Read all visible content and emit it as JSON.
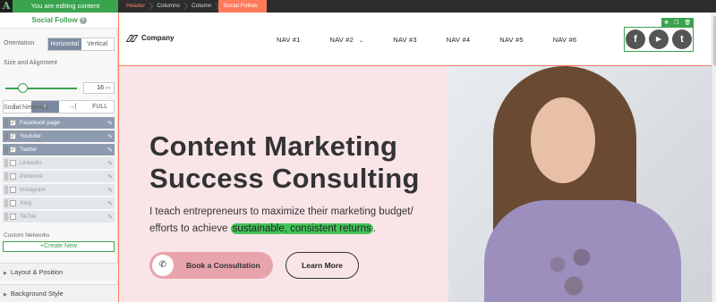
{
  "topbar": {
    "logo": "A",
    "editing": "You are editing content",
    "breadcrumbs": [
      "Header",
      "Columns",
      "Column",
      "Social Follow"
    ]
  },
  "panel": {
    "title": "Social Follow",
    "help": "?",
    "orientation_label": "Orientation",
    "orientation_options": [
      "Horizontal",
      "Vertical"
    ],
    "size_label": "Size and Alignment",
    "size_value": "16",
    "size_unit": "PX",
    "align_options": [
      "|←",
      "+",
      "→|",
      "FULL"
    ],
    "networks_label": "Social Networks",
    "networks": [
      {
        "name": "Facebook page",
        "enabled": true
      },
      {
        "name": "Youtube",
        "enabled": true
      },
      {
        "name": "Twitter",
        "enabled": true
      },
      {
        "name": "LinkedIn",
        "enabled": false
      },
      {
        "name": "Pinterest",
        "enabled": false
      },
      {
        "name": "Instagram",
        "enabled": false
      },
      {
        "name": "Xing",
        "enabled": false
      },
      {
        "name": "TikTok",
        "enabled": false
      }
    ],
    "custom_label": "Custom Networks",
    "create_new": "+Create New",
    "sections": [
      "Layout & Position",
      "Background Style"
    ]
  },
  "site": {
    "brand": "Company",
    "nav": [
      "NAV #1",
      "NAV #2",
      "NAV #3",
      "NAV #4",
      "NAV #5",
      "NAV #6"
    ],
    "social": [
      "f",
      "▶",
      "t"
    ],
    "headline_1": "Content Marketing",
    "headline_2": "Success Consulting",
    "sub_1": "I teach entrepreneurs to maximize their marketing budget/",
    "sub_2": "efforts to achieve",
    "sub_highlight": "sustainable, consistent returns",
    "sub_end": ".",
    "cta_primary": "Book a Consultation",
    "cta_secondary": "Learn More"
  },
  "colors": {
    "accent_green": "#3aa34e",
    "accent_orange": "#ff7b5c",
    "hero_bg": "#f9e5e8",
    "button_pink": "#e8a4ad"
  }
}
